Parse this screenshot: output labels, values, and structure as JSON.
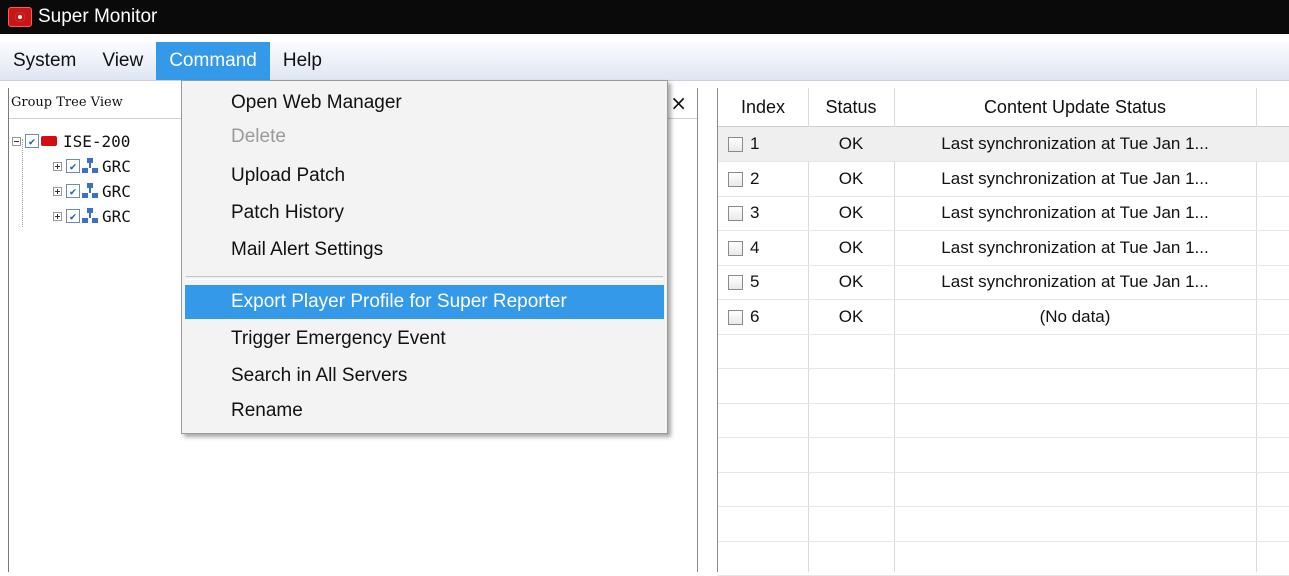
{
  "window": {
    "title": "Super Monitor"
  },
  "menubar": {
    "items": [
      "System",
      "View",
      "Command",
      "Help"
    ],
    "active": "Command"
  },
  "left_panel": {
    "header": "Group Tree View",
    "close_glyph": "×",
    "tree": {
      "server_label": "ISE-200",
      "groups": [
        "GRC",
        "GRC",
        "GRC"
      ]
    }
  },
  "command_menu": {
    "items": [
      {
        "label": "Open Web Manager",
        "enabled": true
      },
      {
        "label": "Delete",
        "enabled": false
      },
      {
        "label": "Upload Patch",
        "enabled": true
      },
      {
        "label": "Patch History",
        "enabled": true
      },
      {
        "label": "Mail Alert Settings",
        "enabled": true
      },
      {
        "label": "Export Player Profile for Super Reporter",
        "enabled": true,
        "highlighted": true
      },
      {
        "label": "Trigger Emergency Event",
        "enabled": true
      },
      {
        "label": "Search in All Servers",
        "enabled": true
      },
      {
        "label": "Rename",
        "enabled": true
      }
    ]
  },
  "table": {
    "columns": [
      "Index",
      "Status",
      "Content Update Status"
    ],
    "rows": [
      {
        "index": "1",
        "status": "OK",
        "content": "Last synchronization at Tue Jan 1..."
      },
      {
        "index": "2",
        "status": "OK",
        "content": "Last synchronization at Tue Jan 1..."
      },
      {
        "index": "3",
        "status": "OK",
        "content": "Last synchronization at Tue Jan 1..."
      },
      {
        "index": "4",
        "status": "OK",
        "content": "Last synchronization at Tue Jan 1..."
      },
      {
        "index": "5",
        "status": "OK",
        "content": "Last synchronization at Tue Jan 1..."
      },
      {
        "index": "6",
        "status": "OK",
        "content": "(No data)"
      }
    ]
  },
  "colors": {
    "accent": "#3399e8",
    "titlebar": "#0a0a0a",
    "server_icon": "#d01010"
  }
}
